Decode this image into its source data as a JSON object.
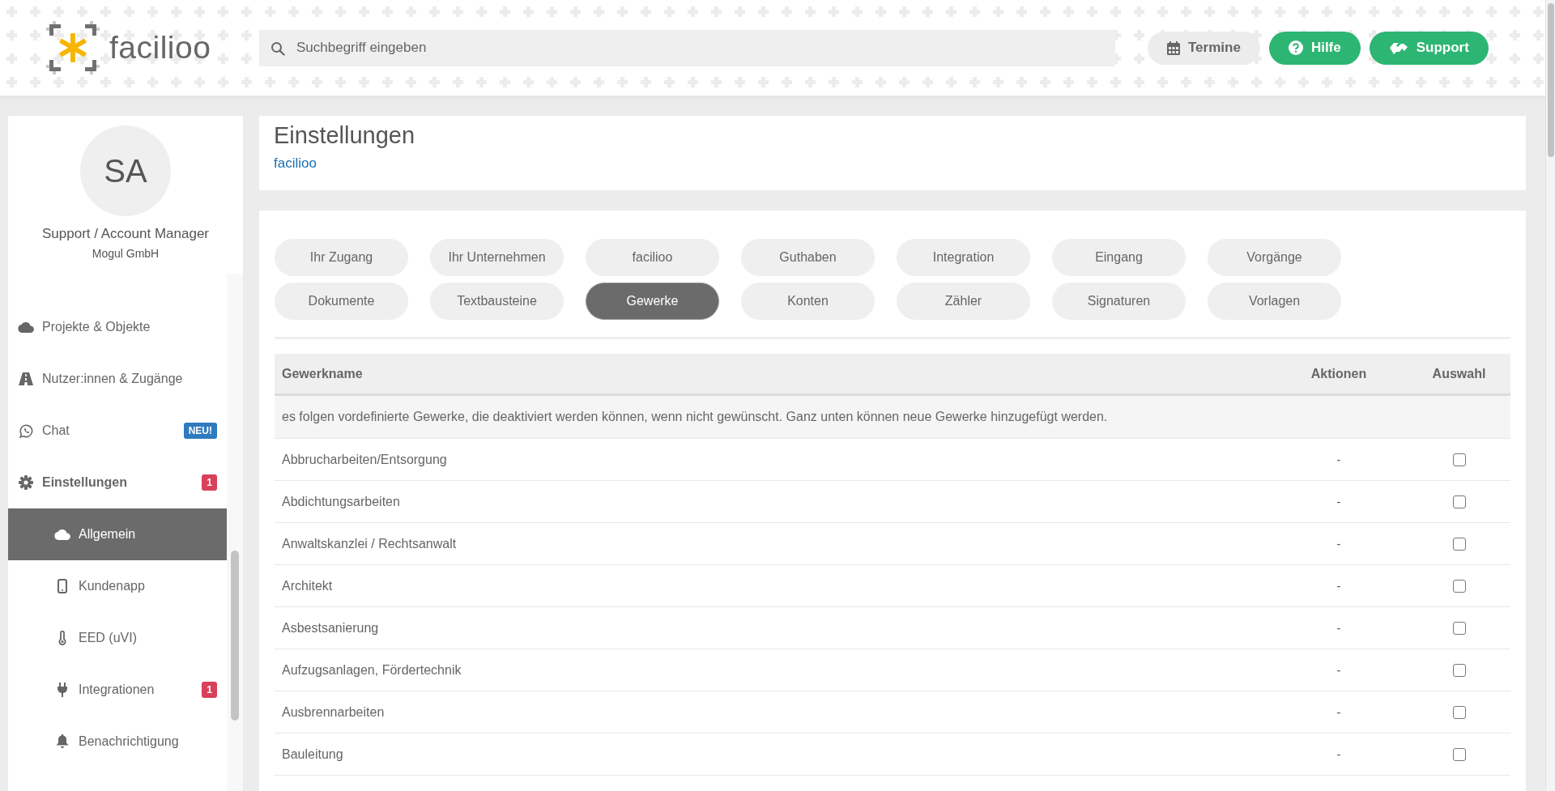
{
  "header": {
    "logo_text": "facilioo",
    "search": {
      "placeholder": "Suchbegriff eingeben"
    },
    "buttons": [
      {
        "label": "Termine",
        "kind": "calendar",
        "primary": false
      },
      {
        "label": "Hilfe",
        "kind": "help",
        "primary": true
      },
      {
        "label": "Support",
        "kind": "support",
        "primary": true
      }
    ]
  },
  "profile": {
    "initials": "SA",
    "role": "Support / Account Manager",
    "company": "Mogul GmbH"
  },
  "sidebar": {
    "items": [
      {
        "label": "Projekte & Objekte",
        "kind": "cloud",
        "selected": false,
        "expanded": false
      },
      {
        "label": "Nutzer:innen & Zugänge",
        "kind": "road",
        "selected": false,
        "expanded": false
      },
      {
        "label": "Chat",
        "kind": "chat",
        "selected": false,
        "expanded": false,
        "badge": {
          "text": "NEU!",
          "color": "#2f7bbf"
        }
      },
      {
        "label": "Einstellungen",
        "kind": "gear",
        "selected": false,
        "expanded": true,
        "badge": {
          "text": "1",
          "color": "#d9405a"
        },
        "children": [
          {
            "label": "Allgemein",
            "kind": "cloud",
            "selected": true
          },
          {
            "label": "Kundenapp",
            "kind": "phone",
            "selected": false
          },
          {
            "label": "EED (uVI)",
            "kind": "thermometer",
            "selected": false
          },
          {
            "label": "Integrationen",
            "kind": "plug",
            "selected": false,
            "badge": {
              "text": "1",
              "color": "#d9405a"
            }
          },
          {
            "label": "Benachrichtigung",
            "kind": "bell",
            "selected": false
          }
        ]
      }
    ]
  },
  "page": {
    "title": "Einstellungen",
    "breadcrumb": "facilioo",
    "tabs": [
      {
        "label": "Ihr Zugang",
        "selected": false
      },
      {
        "label": "Ihr Unternehmen",
        "selected": false
      },
      {
        "label": "facilioo",
        "selected": false
      },
      {
        "label": "Guthaben",
        "selected": false
      },
      {
        "label": "Integration",
        "selected": false
      },
      {
        "label": "Eingang",
        "selected": false
      },
      {
        "label": "Vorgänge",
        "selected": false
      },
      {
        "label": "Dokumente",
        "selected": false
      },
      {
        "label": "Textbausteine",
        "selected": false
      },
      {
        "label": "Gewerke",
        "selected": true
      },
      {
        "label": "Konten",
        "selected": false
      },
      {
        "label": "Zähler",
        "selected": false
      },
      {
        "label": "Signaturen",
        "selected": false
      },
      {
        "label": "Vorlagen",
        "selected": false
      }
    ],
    "table": {
      "columns": [
        "Gewerkname",
        "Aktionen",
        "Auswahl"
      ],
      "note": "es folgen vordefinierte Gewerke, die deaktiviert werden können, wenn nicht gewünscht. Ganz unten können neue Gewerke hinzugefügt werden.",
      "rows": [
        {
          "name": "Abbrucharbeiten/Entsorgung",
          "actions": "-",
          "checked": false
        },
        {
          "name": "Abdichtungsarbeiten",
          "actions": "-",
          "checked": false
        },
        {
          "name": "Anwaltskanzlei / Rechtsanwalt",
          "actions": "-",
          "checked": false
        },
        {
          "name": "Architekt",
          "actions": "-",
          "checked": false
        },
        {
          "name": "Asbestsanierung",
          "actions": "-",
          "checked": false
        },
        {
          "name": "Aufzugsanlagen, Fördertechnik",
          "actions": "-",
          "checked": false
        },
        {
          "name": "Ausbrennarbeiten",
          "actions": "-",
          "checked": false
        },
        {
          "name": "Bauleitung",
          "actions": "-",
          "checked": false
        }
      ]
    }
  }
}
